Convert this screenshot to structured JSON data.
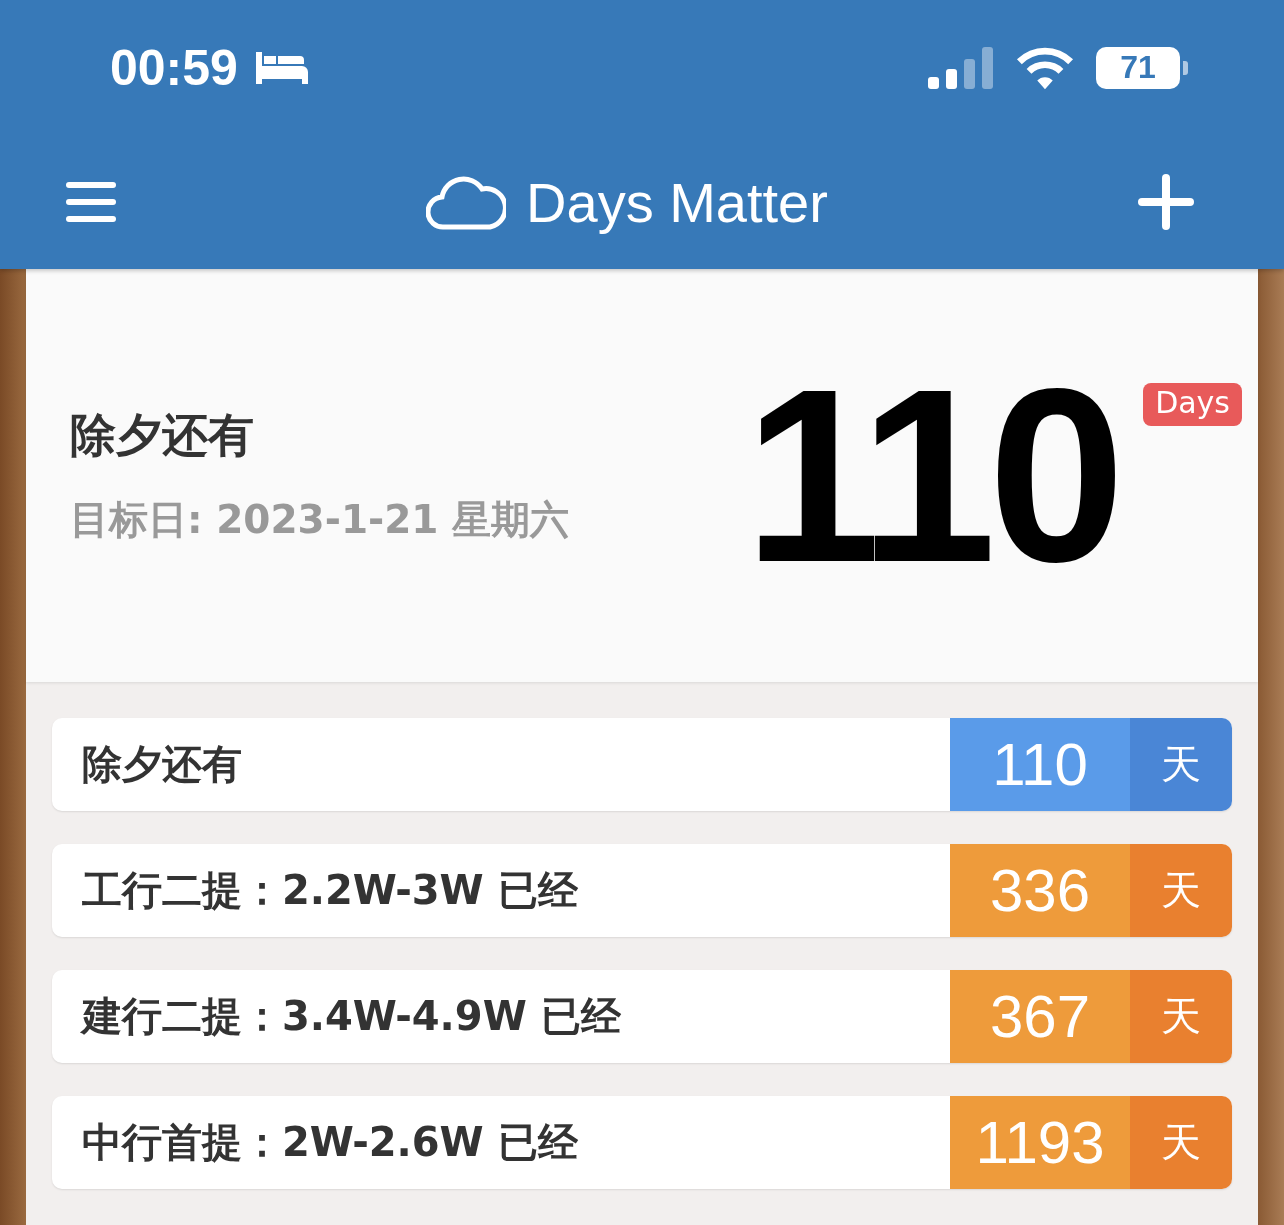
{
  "status_bar": {
    "time": "00:59",
    "battery": "71"
  },
  "nav": {
    "title": "Days Matter"
  },
  "featured": {
    "title": "除夕还有",
    "target": "目标日: 2023-1-21 星期六",
    "count": "110",
    "badge": "Days"
  },
  "events": [
    {
      "title": "除夕还有",
      "count": "110",
      "unit": "天",
      "kind": "countdown"
    },
    {
      "title": "工行二提：2.2W-3W 已经",
      "count": "336",
      "unit": "天",
      "kind": "elapsed"
    },
    {
      "title": "建行二提：3.4W-4.9W 已经",
      "count": "367",
      "unit": "天",
      "kind": "elapsed"
    },
    {
      "title": "中行首提：2W-2.6W 已经",
      "count": "1193",
      "unit": "天",
      "kind": "elapsed"
    }
  ]
}
